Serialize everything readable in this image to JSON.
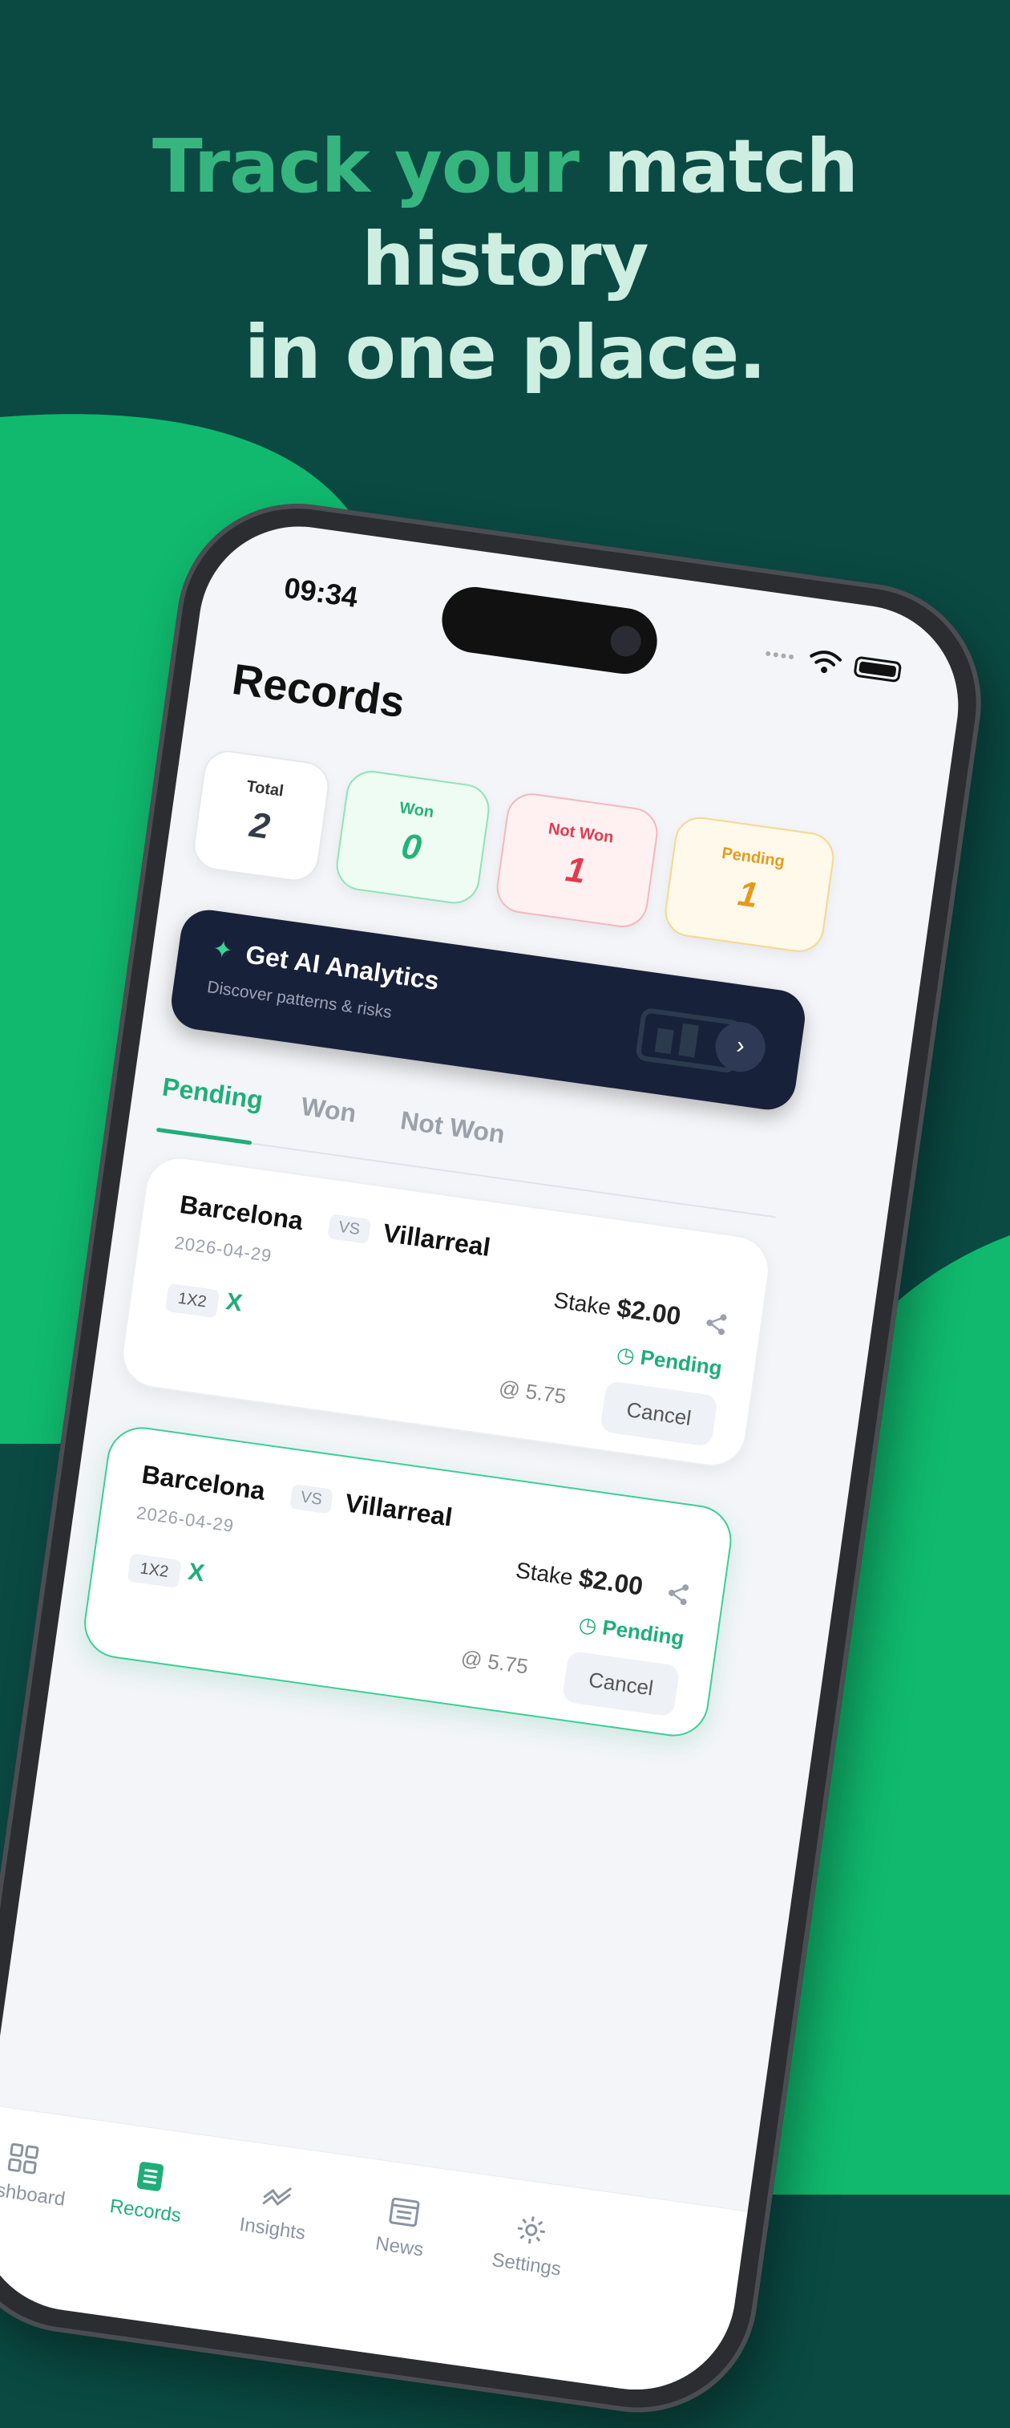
{
  "headline": {
    "accent": "Track your",
    "rest_line1": " match history",
    "line2": "in one place."
  },
  "status_bar": {
    "time": "09:34"
  },
  "page": {
    "title": "Records"
  },
  "stats": [
    {
      "key": "total",
      "label": "Total",
      "value": "2"
    },
    {
      "key": "won",
      "label": "Won",
      "value": "0"
    },
    {
      "key": "notwon",
      "label": "Not Won",
      "value": "1"
    },
    {
      "key": "pending",
      "label": "Pending",
      "value": "1"
    }
  ],
  "ai_banner": {
    "title": "Get AI Analytics",
    "subtitle": "Discover patterns & risks"
  },
  "tabs": [
    "Pending",
    "Won",
    "Not Won"
  ],
  "records": [
    {
      "home": "Barcelona",
      "vs": "VS",
      "away": "Villarreal",
      "date": "2026-04-29",
      "market": "1X2",
      "pick": "X",
      "stake_label": "Stake",
      "stake": "$2.00",
      "status": "Pending",
      "odds": "@ 5.75",
      "cancel": "Cancel"
    },
    {
      "home": "Barcelona",
      "vs": "VS",
      "away": "Villarreal",
      "date": "2026-04-29",
      "market": "1X2",
      "pick": "X",
      "stake_label": "Stake",
      "stake": "$2.00",
      "status": "Pending",
      "odds": "@ 5.75",
      "cancel": "Cancel"
    }
  ],
  "tabbar": [
    {
      "label": "Dashboard",
      "icon": "grid-icon"
    },
    {
      "label": "Records",
      "icon": "list-icon"
    },
    {
      "label": "Insights",
      "icon": "trend-icon"
    },
    {
      "label": "News",
      "icon": "news-icon"
    },
    {
      "label": "Settings",
      "icon": "gear-icon"
    }
  ],
  "colors": {
    "background": "#0a4a43",
    "blob": "#10b96e",
    "accent": "#1fae78",
    "won": "#22b377",
    "not_won": "#e23a4e",
    "pending": "#e69a1a",
    "ai_banner": "#18213a"
  }
}
